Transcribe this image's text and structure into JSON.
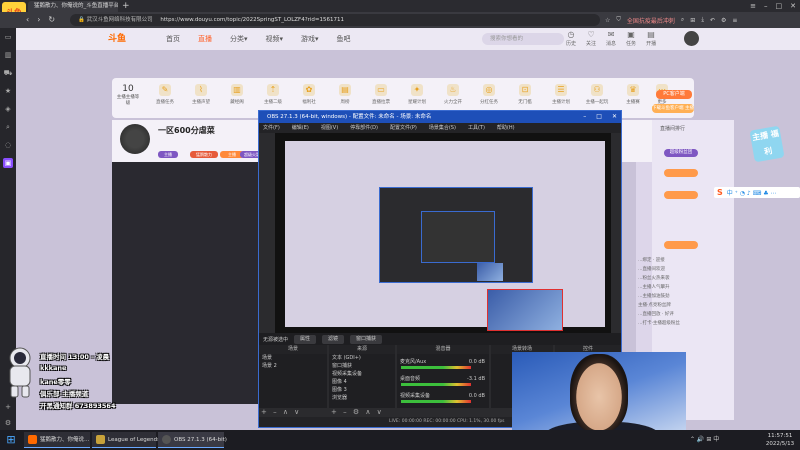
{
  "browser": {
    "tab_title": "猛鹅散力、你俺说的_斗鱼直播平台",
    "new_tab": "+",
    "url_site": "武汉斗鱼网络科技有限公司",
    "url": "https://www.douyu.com/topic/2022SpringST_LOLZF4?rid=1561711",
    "site_logo": "斗鱼",
    "right_tool_label": "全国抗疫最后冲刺"
  },
  "nav": {
    "logo": "斗鱼",
    "links": [
      "首页",
      "直播",
      "分类▾",
      "视频▾",
      "游戏▾",
      "鱼吧"
    ],
    "search_placeholder": "搜索你想看的",
    "icons": [
      {
        "glyph": "◷",
        "label": "历史"
      },
      {
        "glyph": "♡",
        "label": "关注"
      },
      {
        "glyph": "✉",
        "label": "消息"
      },
      {
        "glyph": "▣",
        "label": "任务"
      },
      {
        "glyph": "▤",
        "label": "开播"
      }
    ]
  },
  "toolbar": {
    "level_num": "10",
    "level_label": "主播主播等级",
    "items": [
      "直播任务",
      "主播声望",
      "藏经阁",
      "主播二级",
      "福利社",
      "周榜",
      "直播拉票",
      "星耀计划",
      "火力全开",
      "分红任务",
      "无门槛",
      "主播计划",
      "主播一起玩",
      "主播赛",
      "更多"
    ],
    "pc_client": "PC客户端",
    "download": "下载斗鱼客户端 主播"
  },
  "streamer": {
    "room_title": "一区600分虐菜",
    "tags": [
      "主播",
      "猛鹅散力",
      "主播",
      "超级火箭"
    ],
    "rank_title": "直播间排行",
    "fans_pill": "超级粉丝团"
  },
  "wow_badge": "主播\n福利",
  "sogou": {
    "logo": "S",
    "icons": "中 ⁺ ◔ ♪ ⌨ ♣ ⋯"
  },
  "chat_lines": [
    "…绑定 · 迎接",
    "…直播间欢迎",
    "…粉丝火热来袭",
    "…主播人气攀升",
    "…主播加油鼓劲",
    "主播·点亮粉丝牌",
    "…直播回放 · 好评",
    "…打卡·主播超级粉丝"
  ],
  "overlay": {
    "line1": "直播时间 13:00 - 凌晨",
    "line2": "kkkane",
    "line3": "kane零零",
    "line4": "俱乐部-主播频道",
    "line5": "开黑通知群 673893564"
  },
  "obs": {
    "title": "OBS 27.1.3 (64-bit, windows) - 配置文件: 未命名 - 场景: 未命名",
    "menu": [
      "文件(F)",
      "编辑(E)",
      "视图(V)",
      "停靠部件(D)",
      "配置文件(P)",
      "场景集合(S)",
      "工具(T)",
      "帮助(H)"
    ],
    "status_strip": [
      "无源被选中",
      "属性",
      "滤镜",
      "窗口捕获"
    ],
    "docks": {
      "scenes": {
        "header": "场景",
        "items": [
          "场景",
          "场景 2"
        ]
      },
      "sources": {
        "header": "来源",
        "items": [
          "文本 (GDI+)",
          "窗口捕获",
          "视频采集设备",
          "图像 4",
          "图像 3",
          "浏览器"
        ]
      },
      "mixer": {
        "header": "混音器",
        "items": [
          "麦克风/Aux",
          "桌面音频",
          "视频采集设备"
        ],
        "levels": [
          "0.0 dB",
          "-3.1 dB",
          "0.0 dB"
        ]
      },
      "transitions": {
        "header": "场景转场"
      },
      "controls": {
        "header": "控件"
      }
    },
    "statusbar": "LIVE: 00:00:00    REC: 00:00:00    CPU: 1.1%, 30.00 fps"
  },
  "taskbar": {
    "start": "⊞",
    "tasks": [
      {
        "label": "猛鹅散力、你俺说…",
        "color": "#ff6a00"
      },
      {
        "label": "League of Legends",
        "color": "#c8a23a"
      },
      {
        "label": "OBS 27.1.3 (64-bit)",
        "color": "#555"
      }
    ],
    "tray": "⌃ 🔊 ⊞ 中",
    "time": "11:57:51",
    "date": "2022/5/13"
  }
}
